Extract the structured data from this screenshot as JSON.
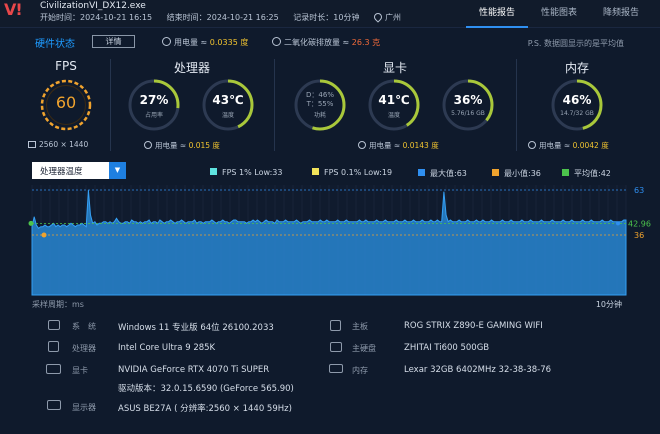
{
  "header": {
    "logo": "V!",
    "app_name": "CivilizationVI_DX12.exe",
    "start_label": "开始时间：2024-10-21 16:15",
    "end_label": "结束时间：2024-10-21 16:25",
    "duration_label": "记录时长：10分钟",
    "location": "广州",
    "tabs": [
      {
        "label": "性能报告",
        "active": true
      },
      {
        "label": "性能图表",
        "active": false
      },
      {
        "label": "降频报告",
        "active": false
      }
    ]
  },
  "status": {
    "title": "硬件状态",
    "detail_button": "详情",
    "power_label": "用电量 ≈",
    "power_value": "0.0335 度",
    "co2_label": "二氧化碳排放量 ≈",
    "co2_value": "26.3 克",
    "note": "P.S. 数据圆显示的是平均值"
  },
  "metrics": {
    "fps": {
      "title": "FPS",
      "value": "60",
      "resolution": "2560 × 1440",
      "fraction": 0.88
    },
    "cpu": {
      "title": "处理器",
      "usage_value": "27%",
      "usage_label": "占用率",
      "usage_fraction": 0.27,
      "temp_value": "43℃",
      "temp_label": "温度",
      "temp_fraction": 0.43,
      "power_label": "用电量 ≈",
      "power_value": "0.015 度"
    },
    "gpu": {
      "title": "显卡",
      "dt_d": "D：46%",
      "dt_t": "T：55%",
      "dt_label": "功耗",
      "temp_value": "41℃",
      "temp_label": "温度",
      "temp_fraction": 0.41,
      "mem_value": "36%",
      "mem_label": "5.76/16 GB",
      "mem_fraction": 0.36,
      "power_label": "用电量 ≈",
      "power_value": "0.0143 度"
    },
    "ram": {
      "title": "内存",
      "value": "46%",
      "label": "14.7/32 GB",
      "fraction": 0.46,
      "power_label": "用电量 ≈",
      "power_value": "0.0042 度"
    }
  },
  "chart_controls": {
    "selected": "处理器温度",
    "legend": [
      {
        "label": "FPS 1% Low:33",
        "color": "#5fe3e0"
      },
      {
        "label": "FPS 0.1% Low:19",
        "color": "#f2e35a"
      },
      {
        "label": "最大值:63",
        "color": "#2f8ff0"
      },
      {
        "label": "最小值:36",
        "color": "#f0a32e"
      },
      {
        "label": "平均值:42",
        "color": "#4cc34c"
      }
    ]
  },
  "chart_data": {
    "type": "area",
    "series_name": "处理器温度",
    "max": 63,
    "min": 36,
    "avg": 42.96,
    "avg_label": "42.96",
    "max_label": "63",
    "min_label": "36",
    "ylim": [
      0,
      66
    ],
    "values": [
      41,
      47,
      42,
      40,
      41,
      41,
      42,
      41,
      41,
      42,
      43,
      41,
      42,
      41,
      42,
      42,
      41,
      42,
      43,
      42,
      41,
      42,
      42,
      43,
      42,
      41,
      63,
      48,
      43,
      44,
      42,
      43,
      43,
      44,
      44,
      43,
      44,
      43,
      44,
      46,
      44,
      43,
      43,
      44,
      44,
      43,
      45,
      44,
      44,
      43,
      44,
      43,
      44,
      44,
      45,
      43,
      44,
      44,
      43,
      45,
      44,
      43,
      44,
      44,
      45,
      44,
      43,
      44,
      44,
      45,
      44,
      43,
      44,
      44,
      44,
      45,
      43,
      44,
      44,
      43,
      44,
      44,
      44,
      45,
      44,
      43,
      44,
      44,
      45,
      44,
      44,
      43,
      44,
      45,
      45,
      44,
      44,
      44,
      44,
      43,
      44,
      44,
      45,
      44,
      45,
      44,
      43,
      44,
      45,
      44,
      44,
      44,
      43,
      45,
      44,
      44,
      44,
      45,
      44,
      44,
      44,
      44,
      45,
      44,
      43,
      44,
      44,
      44,
      45,
      44,
      44,
      44,
      44,
      45,
      44,
      44,
      45,
      44,
      44,
      44,
      44,
      45,
      44,
      44,
      44,
      45,
      44,
      44,
      44,
      44,
      44,
      45,
      44,
      44,
      45,
      44,
      44,
      44,
      44,
      45,
      44,
      44,
      44,
      45,
      44,
      44,
      44,
      44,
      45,
      44,
      44,
      44,
      45,
      44,
      44,
      44,
      45,
      44,
      44,
      44,
      45,
      44,
      44,
      44,
      45,
      44,
      44,
      45,
      44,
      44,
      62,
      48,
      44,
      45,
      44,
      44,
      44,
      45,
      44,
      44,
      44,
      45,
      44,
      44,
      44,
      45,
      44,
      44,
      45,
      44,
      44,
      44,
      45,
      44,
      44,
      44,
      44,
      45,
      44,
      44,
      44,
      45,
      44,
      44,
      44,
      44,
      45,
      44,
      44,
      44,
      45,
      44,
      44,
      44,
      44,
      45,
      44,
      44,
      44,
      44,
      45,
      44,
      44,
      44,
      44,
      45,
      44,
      44,
      44,
      45,
      44,
      44,
      44,
      44,
      45,
      44,
      44,
      44,
      45,
      44,
      44,
      44,
      44,
      45,
      44,
      44,
      44,
      45,
      44,
      44,
      44,
      44,
      44,
      45,
      45
    ],
    "sample_label": "采样周期：ms",
    "end_label": "10分钟"
  },
  "system_info": {
    "left": [
      {
        "label": "系　统",
        "value": "Windows 11 专业版 64位 26100.2033",
        "icon": "os-icon"
      },
      {
        "label": "处理器",
        "value": "Intel Core Ultra 9 285K",
        "icon": "cpu-icon"
      },
      {
        "label": "显卡",
        "value": "NVIDIA GeForce RTX 4070 Ti SUPER",
        "value2": "驱动版本：32.0.15.6590 (GeForce 565.90)",
        "icon": "gpu-icon"
      },
      {
        "label": "显示器",
        "value": "ASUS BE27A ( 分辨率:2560 × 1440 59Hz)",
        "icon": "monitor-icon"
      }
    ],
    "right": [
      {
        "label": "主板",
        "value": "ROG STRIX Z890-E GAMING WIFI",
        "icon": "motherboard-icon"
      },
      {
        "label": "主硬盘",
        "value": "ZHITAI Ti600 500GB",
        "icon": "disk-icon"
      },
      {
        "label": "内存",
        "value": "Lexar 32GB 6402MHz 32-38-38-76",
        "icon": "ram-icon"
      }
    ]
  }
}
